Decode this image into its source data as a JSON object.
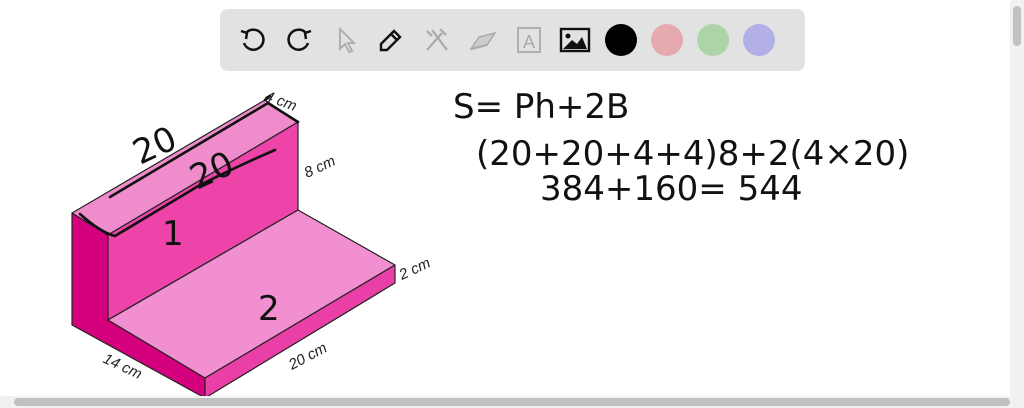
{
  "toolbar": {
    "tools": [
      {
        "icon": "undo-icon"
      },
      {
        "icon": "redo-icon"
      },
      {
        "icon": "select-pointer-icon"
      },
      {
        "icon": "pen-icon"
      },
      {
        "icon": "tools-icon"
      },
      {
        "icon": "eraser-icon"
      },
      {
        "icon": "text-icon",
        "glyph": "A"
      },
      {
        "icon": "image-icon"
      }
    ],
    "colors": [
      "#000000",
      "#e6a9b0",
      "#acd4a8",
      "#b3b0e6"
    ]
  },
  "figure": {
    "labels": {
      "top_depth": "4 cm",
      "height": "8 cm",
      "base_height": "2 cm",
      "length": "20 cm",
      "width": "14 cm"
    },
    "annotations": {
      "top_length": "20",
      "inner_length": "20",
      "wall_mark": "1",
      "base_mark": "2"
    }
  },
  "work": {
    "line1": "S= Ph+2B",
    "line2": "(20+20+4+4)8+2(4×20)",
    "line3": "384+160= 544"
  }
}
